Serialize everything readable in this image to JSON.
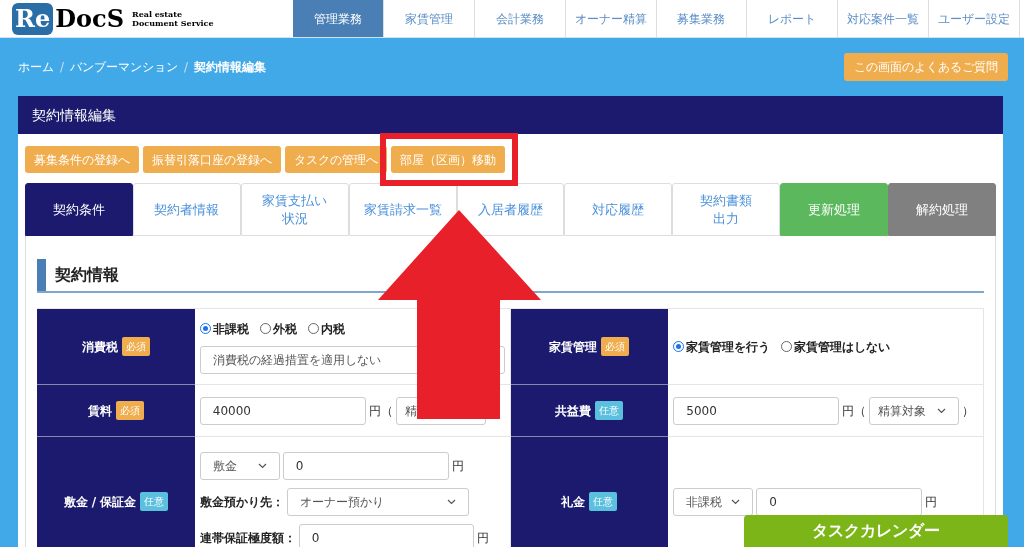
{
  "header": {
    "logo": {
      "mark": "Re",
      "name": "DocS",
      "tagline_1": "Real estate",
      "tagline_2": "Document Service"
    },
    "nav": [
      {
        "label": "管理業務",
        "selected": true
      },
      {
        "label": "家賃管理",
        "selected": false
      },
      {
        "label": "会計業務",
        "selected": false
      },
      {
        "label": "オーナー精算",
        "selected": false
      },
      {
        "label": "募集業務",
        "selected": false
      },
      {
        "label": "レポート",
        "selected": false
      },
      {
        "label": "対応案件一覧",
        "selected": false
      },
      {
        "label": "ユーザー設定",
        "selected": false
      }
    ]
  },
  "breadcrumb": {
    "separator": "/",
    "items": [
      {
        "label": "ホーム",
        "current": false
      },
      {
        "label": "バンブーマンション",
        "current": false
      },
      {
        "label": "契約情報編集",
        "current": true
      }
    ]
  },
  "faq_button": "この画面のよくあるご質問",
  "card": {
    "title": "契約情報編集",
    "action_buttons": [
      {
        "label": "募集条件の登録へ",
        "highlighted": false
      },
      {
        "label": "振替引落口座の登録へ",
        "highlighted": false
      },
      {
        "label": "タスクの管理へ",
        "highlighted": false
      },
      {
        "label": "部屋（区画）移動",
        "highlighted": true
      }
    ],
    "tabs": [
      {
        "lines": [
          "契約条件"
        ],
        "selected": true
      },
      {
        "lines": [
          "契約者情報"
        ],
        "selected": false
      },
      {
        "lines": [
          "家賃支払い",
          "状況"
        ],
        "selected": false
      },
      {
        "lines": [
          "家賃請求一覧"
        ],
        "selected": false
      },
      {
        "lines": [
          "入居者履歴"
        ],
        "selected": false
      },
      {
        "lines": [
          "対応履歴"
        ],
        "selected": false
      },
      {
        "lines": [
          "契約書類",
          "出力"
        ],
        "selected": false
      }
    ],
    "process_buttons": [
      {
        "label": "更新処理",
        "kind": "renew"
      },
      {
        "label": "解約処理",
        "kind": "cancel"
      }
    ],
    "section_title": "契約情報",
    "rows": [
      {
        "cells": [
          {
            "label": "消費税",
            "badge": {
              "text": "必須",
              "kind": "required"
            },
            "lines": [
              [
                {
                  "kind": "radio",
                  "label": "非課税",
                  "selected": true
                },
                {
                  "kind": "radio",
                  "label": "外税",
                  "selected": false
                },
                {
                  "kind": "radio",
                  "label": "内税",
                  "selected": false
                }
              ],
              [
                {
                  "kind": "select",
                  "value": "消費税の経過措置を適用しない"
                }
              ]
            ]
          },
          {
            "label": "家賃管理",
            "badge": {
              "text": "必須",
              "kind": "required"
            },
            "lines": [
              [
                {
                  "kind": "radio",
                  "label": "家賃管理を行う",
                  "selected": true
                },
                {
                  "kind": "radio",
                  "label": "家賃管理はしない",
                  "selected": false
                }
              ]
            ]
          }
        ]
      },
      {
        "cells": [
          {
            "label": "賃料",
            "badge": {
              "text": "必須",
              "kind": "required"
            },
            "lines": [
              [
                {
                  "kind": "input",
                  "value": "40000"
                },
                {
                  "kind": "text",
                  "text": "円（"
                },
                {
                  "kind": "select",
                  "value": "精"
                }
              ]
            ]
          },
          {
            "label": "共益費",
            "badge": {
              "text": "任意",
              "kind": "optional"
            },
            "lines": [
              [
                {
                  "kind": "input",
                  "value": "5000"
                },
                {
                  "kind": "text",
                  "text": "円（"
                },
                {
                  "kind": "select",
                  "value": "精算対象"
                },
                {
                  "kind": "text",
                  "text": "）"
                }
              ]
            ]
          }
        ]
      },
      {
        "cells": [
          {
            "label": "敷金 / 保証金",
            "badge": {
              "text": "任意",
              "kind": "optional"
            },
            "lines": [
              [
                {
                  "kind": "select",
                  "value": "敷金"
                },
                {
                  "kind": "input",
                  "value": "0"
                },
                {
                  "kind": "text",
                  "text": "円"
                }
              ],
              [
                {
                  "kind": "label",
                  "text": "敷金預かり先："
                },
                {
                  "kind": "select",
                  "value": "オーナー預かり"
                }
              ],
              [
                {
                  "kind": "label",
                  "text": "連帯保証極度額："
                },
                {
                  "kind": "input",
                  "value": "0"
                },
                {
                  "kind": "text",
                  "text": "円"
                }
              ]
            ]
          },
          {
            "label": "礼金",
            "badge": {
              "text": "任意",
              "kind": "optional"
            },
            "lines": [
              [
                {
                  "kind": "select",
                  "value": "非課税"
                },
                {
                  "kind": "input",
                  "value": "0"
                },
                {
                  "kind": "text",
                  "text": "円"
                }
              ]
            ]
          }
        ]
      }
    ]
  },
  "task_calendar_button": "タスクカレンダー"
}
